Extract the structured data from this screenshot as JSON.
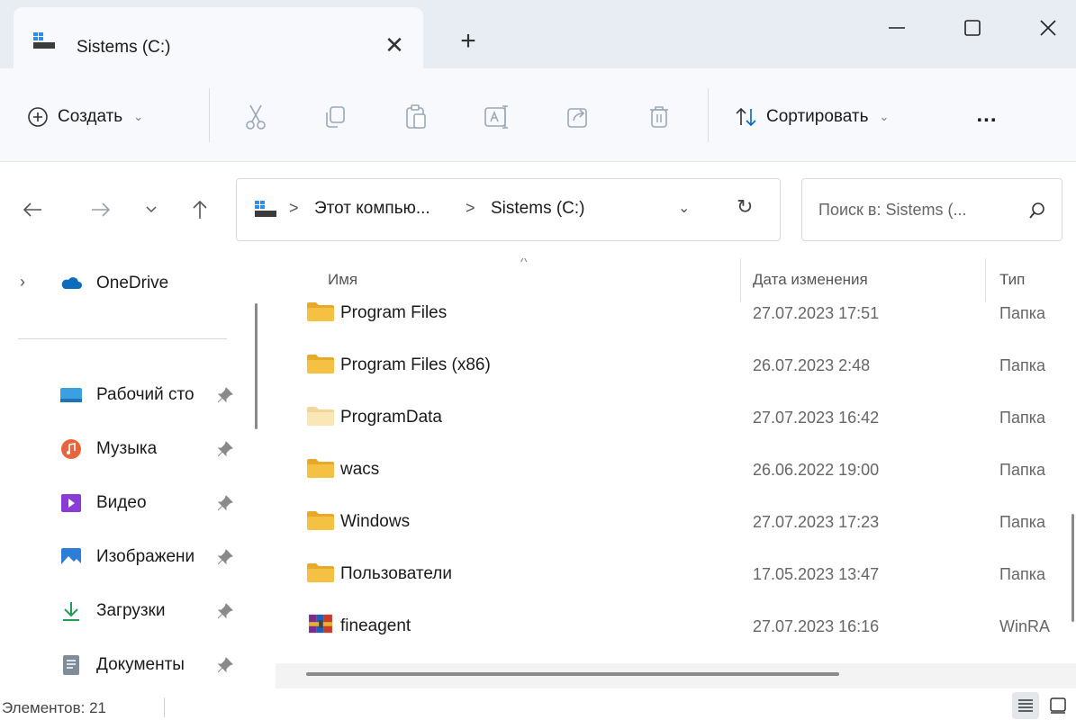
{
  "tab": {
    "title": "Sistems (C:)",
    "close_glyph": "✕",
    "new_tab_glyph": "+"
  },
  "window": {
    "minimize_icon": "minimize-icon",
    "maximize_icon": "maximize-icon",
    "close_icon": "close-icon"
  },
  "toolbar": {
    "create_label": "Создать",
    "sort_label": "Сортировать",
    "more_label": "...",
    "icons": [
      "cut-icon",
      "copy-icon",
      "paste-icon",
      "rename-icon",
      "share-icon",
      "delete-icon"
    ]
  },
  "address": {
    "crumbs": [
      "Этот компью...",
      "Sistems (C:)"
    ],
    "separator": ">",
    "search_placeholder": "Поиск в: Sistems (..."
  },
  "sidebar": {
    "onedrive": "OneDrive",
    "items": [
      {
        "label": "Рабочий сто",
        "icon": "desktop-icon"
      },
      {
        "label": "Музыка",
        "icon": "music-icon"
      },
      {
        "label": "Видео",
        "icon": "video-icon"
      },
      {
        "label": "Изображени",
        "icon": "pictures-icon"
      },
      {
        "label": "Загрузки",
        "icon": "downloads-icon"
      },
      {
        "label": "Документы",
        "icon": "documents-icon"
      }
    ]
  },
  "columns": {
    "name": "Имя",
    "date": "Дата изменения",
    "type": "Тип"
  },
  "files": [
    {
      "name": "Program Files",
      "date": "27.07.2023 17:51",
      "type": "Папка",
      "icon": "folder-icon"
    },
    {
      "name": "Program Files (x86)",
      "date": "26.07.2023 2:48",
      "type": "Папка",
      "icon": "folder-icon"
    },
    {
      "name": "ProgramData",
      "date": "27.07.2023 16:42",
      "type": "Папка",
      "icon": "folder-hidden-icon"
    },
    {
      "name": "wacs",
      "date": "26.06.2022 19:00",
      "type": "Папка",
      "icon": "folder-icon"
    },
    {
      "name": "Windows",
      "date": "27.07.2023 17:23",
      "type": "Папка",
      "icon": "folder-icon"
    },
    {
      "name": "Пользователи",
      "date": "17.05.2023 13:47",
      "type": "Папка",
      "icon": "folder-icon"
    },
    {
      "name": "fineagent",
      "date": "27.07.2023 16:16",
      "type": "WinRA",
      "icon": "winrar-archive-icon"
    }
  ],
  "status": {
    "items_count": "Элементов: 21"
  },
  "colors": {
    "accent": "#0067c0",
    "folder": "#f5c142",
    "titlebar_bg": "#e8ecf3",
    "toolbar_bg": "#f7f9fc"
  }
}
